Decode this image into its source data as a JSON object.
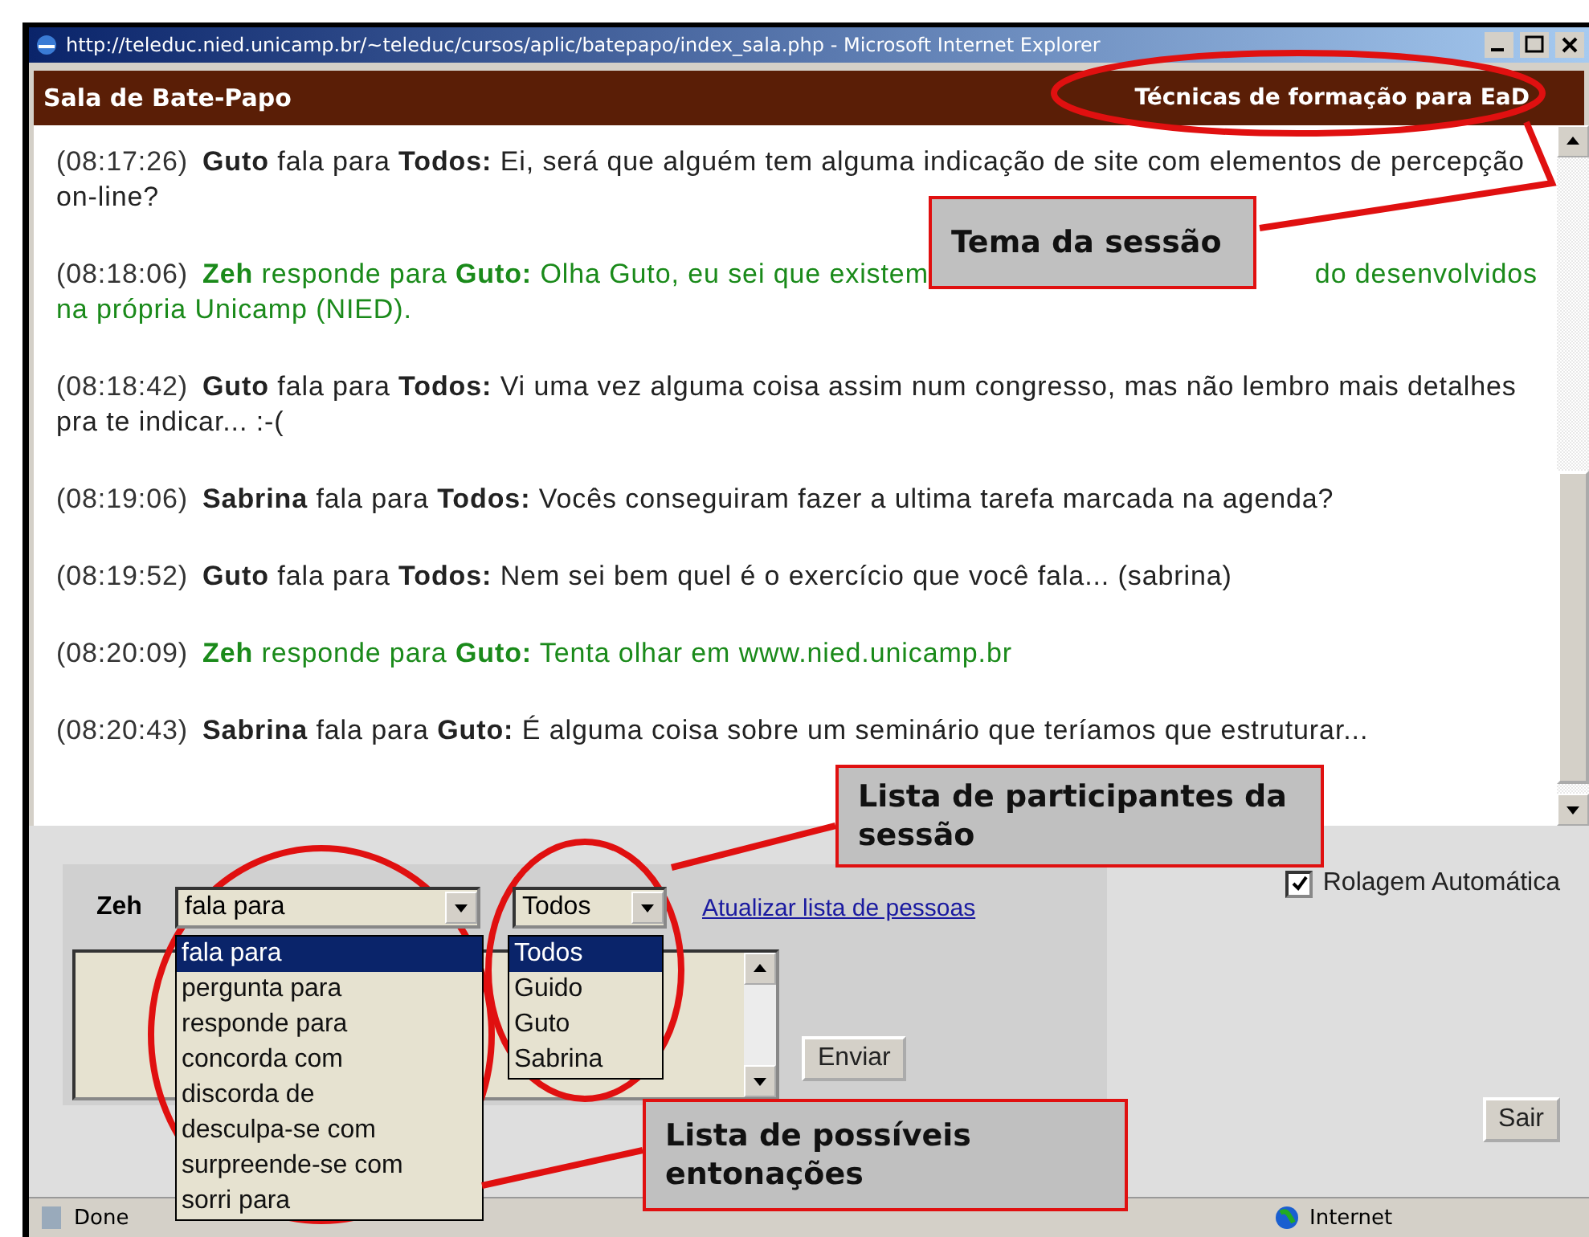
{
  "window": {
    "title": "http://teleduc.nied.unicamp.br/~teleduc/cursos/aplic/batepapo/index_sala.php - Microsoft Internet Explorer"
  },
  "header": {
    "title": "Sala de Bate-Papo",
    "topic": "Técnicas de formação para EaD"
  },
  "messages": [
    {
      "kind": "speech",
      "time": "(08:17:26)",
      "sender": "Guto",
      "verb": "fala para",
      "recipient": "Todos:",
      "text_lines": [
        [
          "Ei, será que alguém tem alguma indicação de site com elementos de percepção"
        ],
        [
          "on-line?"
        ]
      ]
    },
    {
      "kind": "reply",
      "time": "(08:18:06)",
      "sender": "Zeh",
      "verb": "responde para",
      "recipient": "Guto:",
      "text_lines": [
        [
          "Olha Guto, eu sei que existem",
          "do desenvolvidos"
        ],
        [
          "na própria Unicamp (NIED)."
        ]
      ]
    },
    {
      "kind": "speech",
      "time": "(08:18:42)",
      "sender": "Guto",
      "verb": "fala para",
      "recipient": "Todos:",
      "text_lines": [
        [
          "Vi uma vez alguma coisa assim num congresso, mas não lembro mais detalhes"
        ],
        [
          "pra te indicar... :-("
        ]
      ]
    },
    {
      "kind": "speech",
      "time": "(08:19:06)",
      "sender": "Sabrina",
      "verb": "fala para",
      "recipient": "Todos:",
      "text_lines": [
        [
          "Vocês conseguiram fazer a ultima tarefa marcada na agenda?"
        ]
      ]
    },
    {
      "kind": "speech",
      "time": "(08:19:52)",
      "sender": "Guto",
      "verb": "fala para",
      "recipient": "Todos:",
      "text_lines": [
        [
          "Nem sei bem quel é o exercício que você fala... (sabrina)"
        ]
      ]
    },
    {
      "kind": "reply",
      "time": "(08:20:09)",
      "sender": "Zeh",
      "verb": "responde para",
      "recipient": "Guto:",
      "text_lines": [
        [
          "Tenta olhar em www.nied.unicamp.br"
        ]
      ]
    },
    {
      "kind": "speech",
      "time": "(08:20:43)",
      "sender": "Sabrina",
      "verb": "fala para",
      "recipient": "Guto:",
      "text_lines": [
        [
          "É alguma coisa sobre um seminário que teríamos que estruturar..."
        ]
      ]
    }
  ],
  "form": {
    "user": "Zeh",
    "mode_select": {
      "value": "fala para",
      "options": [
        {
          "label": "fala para",
          "selected": true
        },
        {
          "label": "pergunta para",
          "selected": false
        },
        {
          "label": "responde para",
          "selected": false
        },
        {
          "label": "concorda com",
          "selected": false
        },
        {
          "label": "discorda de",
          "selected": false
        },
        {
          "label": "desculpa-se com",
          "selected": false
        },
        {
          "label": "surpreende-se com",
          "selected": false
        },
        {
          "label": "sorri para",
          "selected": false
        }
      ]
    },
    "recipient_select": {
      "value": "Todos",
      "options": [
        {
          "label": "Todos",
          "selected": true
        },
        {
          "label": "Guido",
          "selected": false
        },
        {
          "label": "Guto",
          "selected": false
        },
        {
          "label": "Sabrina",
          "selected": false
        }
      ]
    },
    "refresh_link": "Atualizar lista de pessoas",
    "send_button": "Enviar",
    "auto_scroll": {
      "label": "Rolagem Automática",
      "checked": true
    },
    "exit_button": "Sair"
  },
  "status_bar": {
    "status": "Done",
    "zone": "Internet"
  },
  "annotations": [
    {
      "text": "Tema da sessão"
    },
    {
      "text": "Lista de participantes da sessão"
    },
    {
      "text": "Lista de possíveis entonações"
    }
  ]
}
